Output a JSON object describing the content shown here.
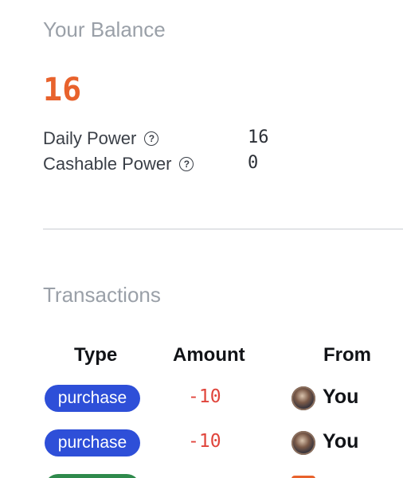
{
  "balance": {
    "title": "Your Balance",
    "value": "16",
    "stats": [
      {
        "label": "Daily Power",
        "value": "16",
        "help_icon": "question-circle-icon"
      },
      {
        "label": "Cashable Power",
        "value": "0",
        "help_icon": "question-circle-icon"
      }
    ]
  },
  "transactions": {
    "title": "Transactions",
    "headers": {
      "type": "Type",
      "amount": "Amount",
      "from": "From"
    },
    "rows": [
      {
        "type": "purchase",
        "amount": "-10",
        "from": "You"
      },
      {
        "type": "purchase",
        "amount": "-10",
        "from": "You"
      }
    ]
  },
  "colors": {
    "balance_value": "#e8622c",
    "muted_title": "#9aa0a8",
    "purchase_pill": "#2e4fd8",
    "partial_pill": "#2f8a4c",
    "negative_amount": "#e0453c"
  }
}
